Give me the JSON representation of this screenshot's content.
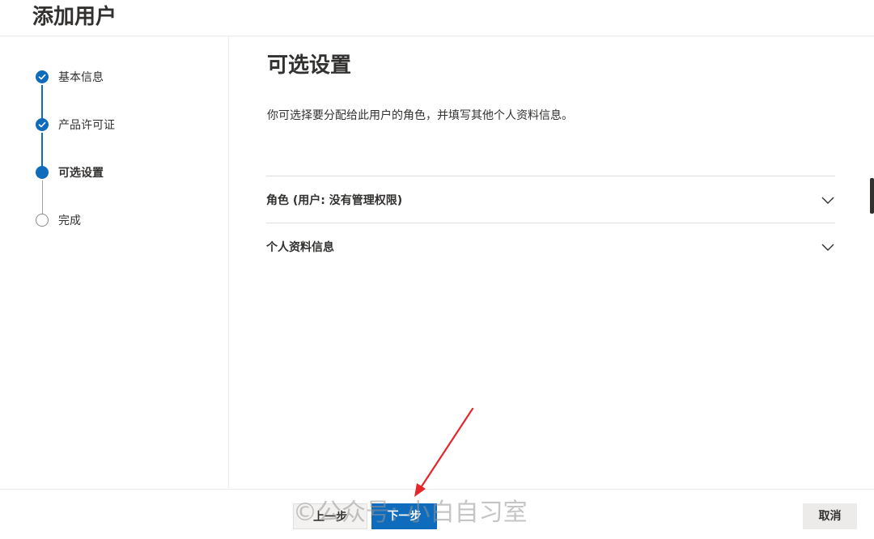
{
  "header": {
    "title": "添加用户"
  },
  "stepper": {
    "steps": [
      {
        "label": "基本信息",
        "state": "done"
      },
      {
        "label": "产品许可证",
        "state": "done"
      },
      {
        "label": "可选设置",
        "state": "current"
      },
      {
        "label": "完成",
        "state": "todo"
      }
    ]
  },
  "main": {
    "title": "可选设置",
    "description": "你可选择要分配给此用户的角色，并填写其他个人资料信息。",
    "sections": [
      {
        "label": "角色 (用户: 没有管理权限)"
      },
      {
        "label": "个人资料信息"
      }
    ]
  },
  "footer": {
    "back_label": "上一步",
    "next_label": "下一步",
    "cancel_label": "取消"
  },
  "watermark": {
    "text": "©公众号: 小白自习室"
  },
  "colors": {
    "accent": "#0f6cbd",
    "annotation_arrow": "#e8252b"
  },
  "icons": {
    "done": "checkmark-icon",
    "chevron": "chevron-down-icon"
  }
}
